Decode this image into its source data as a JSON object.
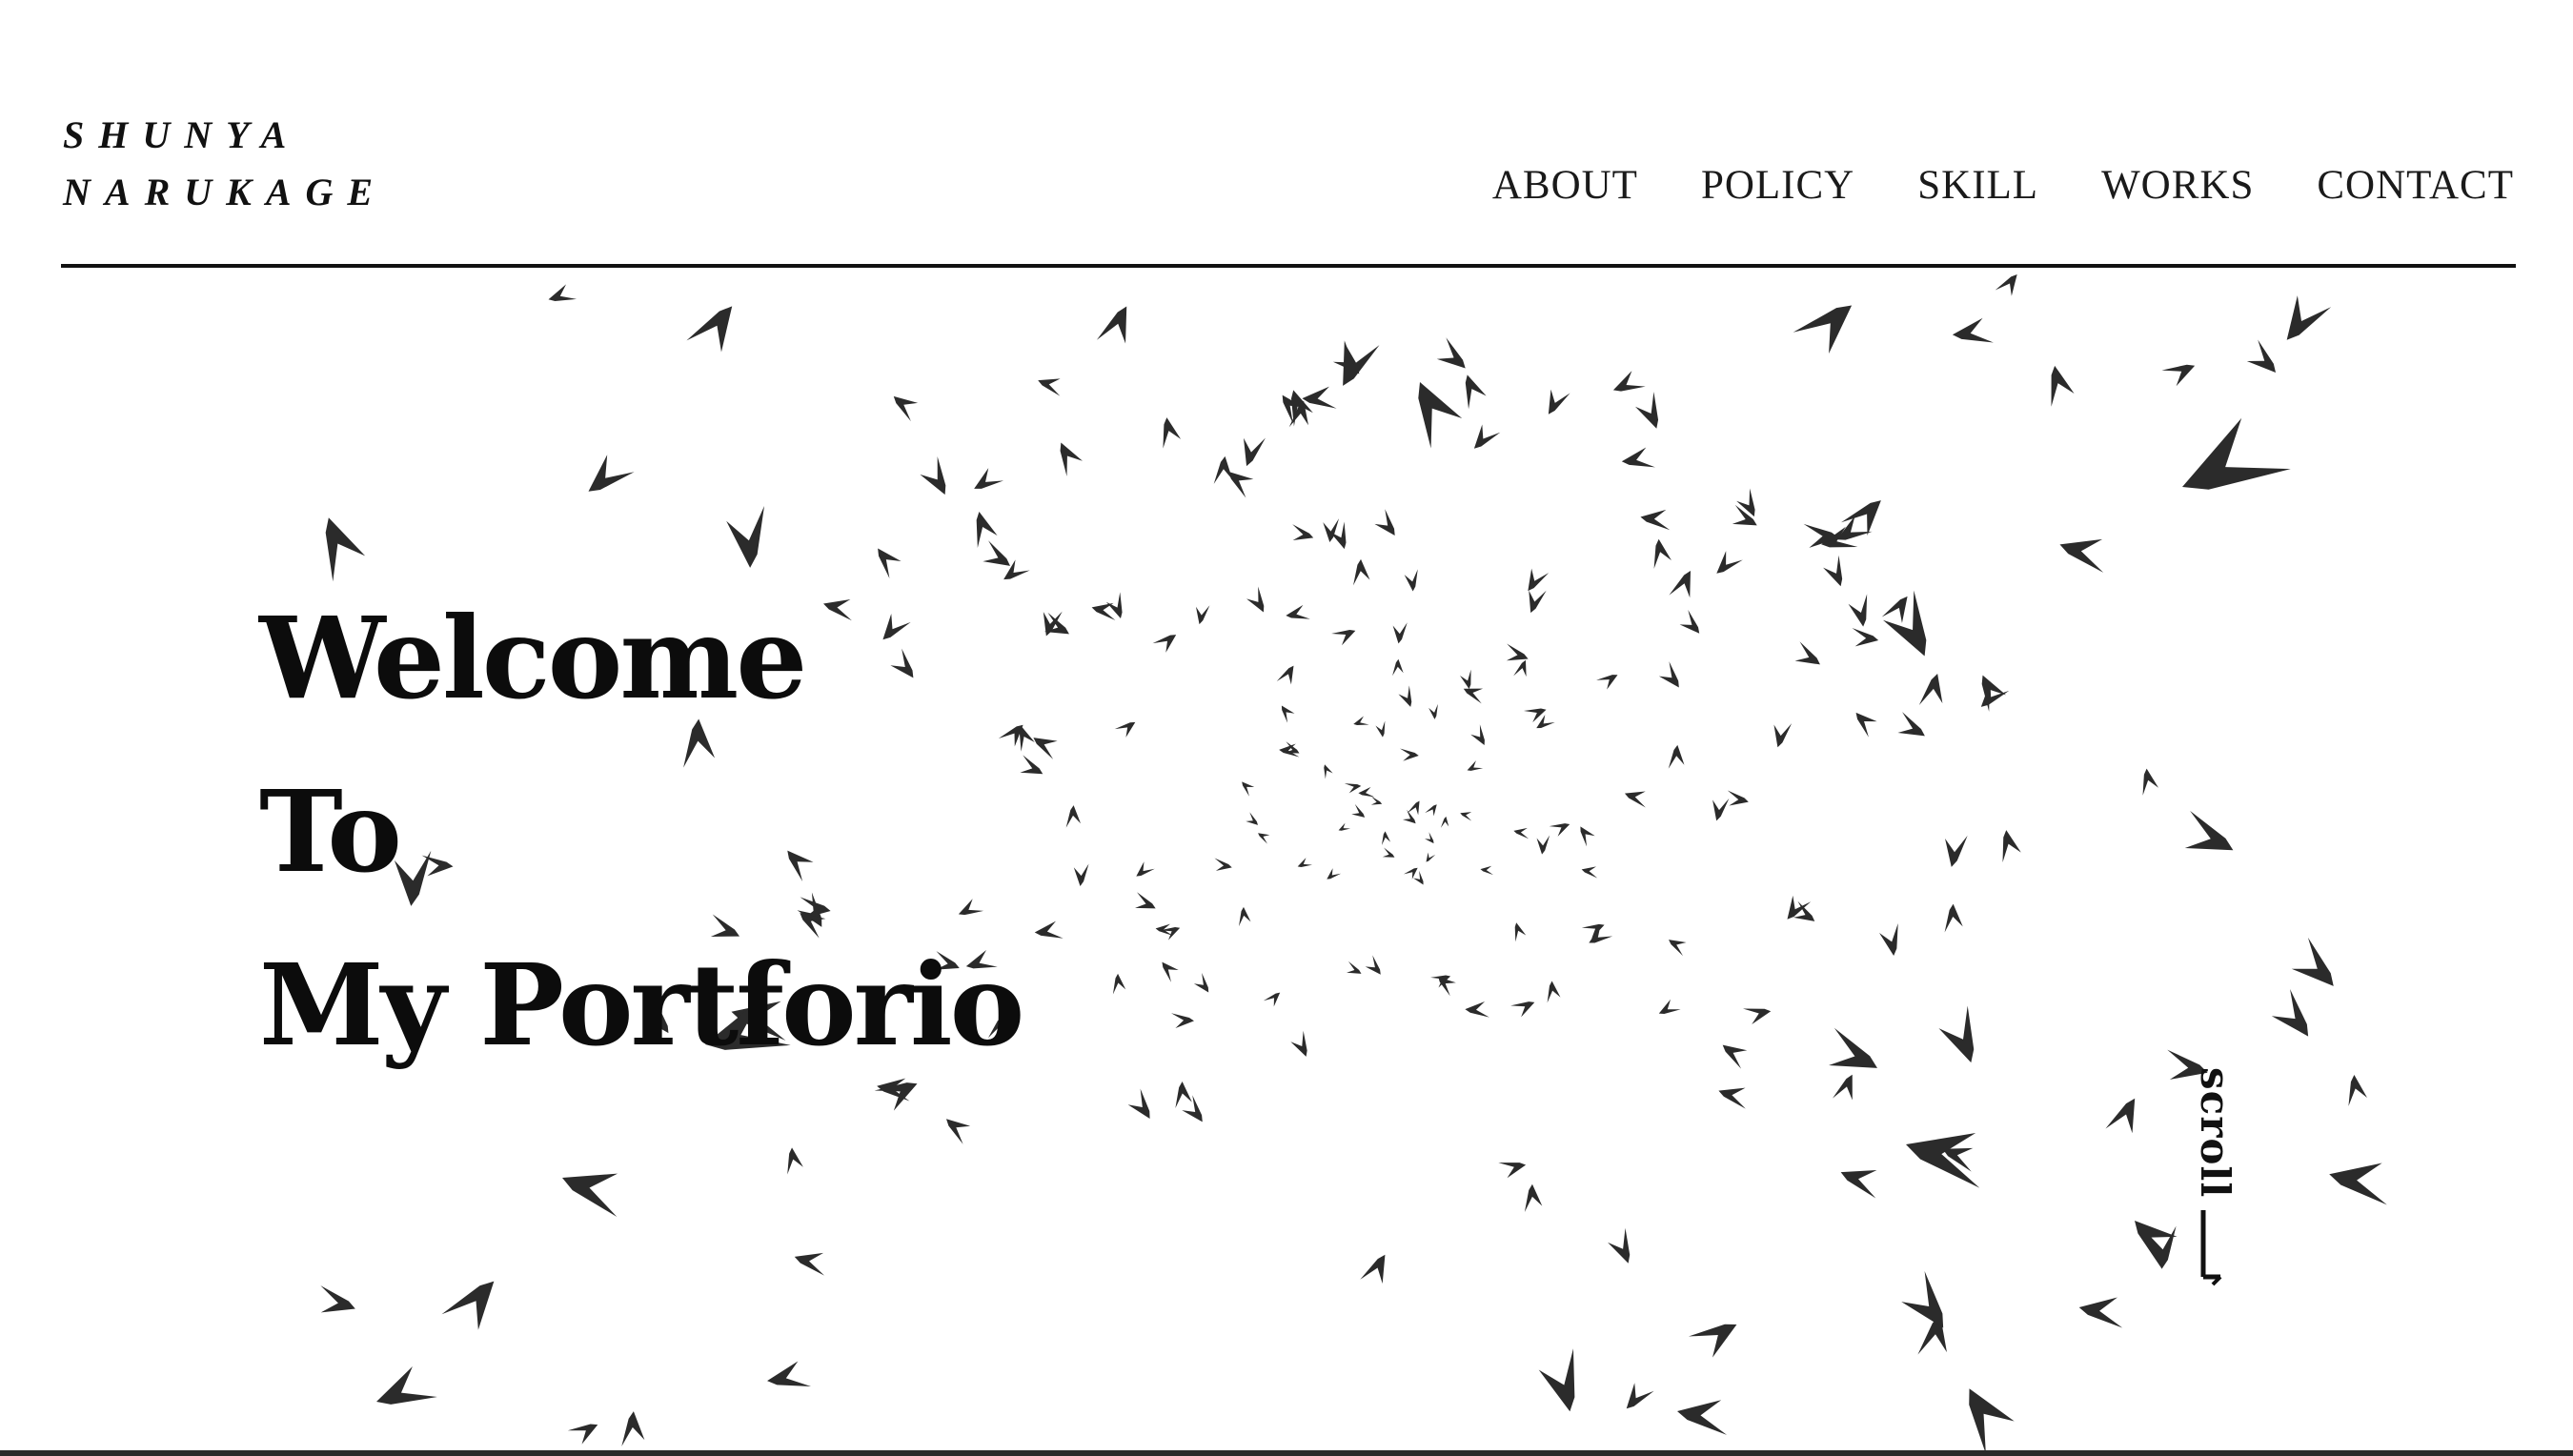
{
  "header": {
    "logo_line1": "SHUNYA",
    "logo_line2": "NARUKAGE",
    "nav": [
      "ABOUT",
      "POLICY",
      "SKILL",
      "WORKS",
      "CONTACT"
    ]
  },
  "hero": {
    "line1": "Welcome",
    "line2": "To",
    "line3": "My Portforio"
  },
  "scroll": {
    "label": "scroll",
    "icon": "arrow-down-icon"
  },
  "colors": {
    "background": "#ffffff",
    "text": "#111111",
    "birds": "#2b2b2b"
  }
}
